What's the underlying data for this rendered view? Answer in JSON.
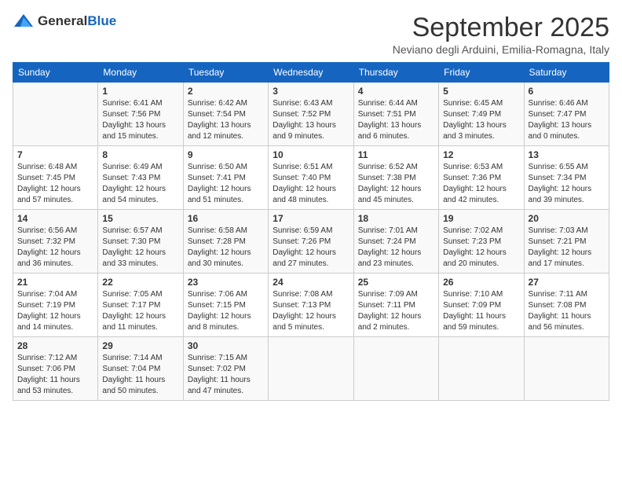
{
  "header": {
    "logo_general": "General",
    "logo_blue": "Blue",
    "month_title": "September 2025",
    "subtitle": "Neviano degli Arduini, Emilia-Romagna, Italy"
  },
  "days_of_week": [
    "Sunday",
    "Monday",
    "Tuesday",
    "Wednesday",
    "Thursday",
    "Friday",
    "Saturday"
  ],
  "weeks": [
    [
      {
        "day": "",
        "info": ""
      },
      {
        "day": "1",
        "info": "Sunrise: 6:41 AM\nSunset: 7:56 PM\nDaylight: 13 hours\nand 15 minutes."
      },
      {
        "day": "2",
        "info": "Sunrise: 6:42 AM\nSunset: 7:54 PM\nDaylight: 13 hours\nand 12 minutes."
      },
      {
        "day": "3",
        "info": "Sunrise: 6:43 AM\nSunset: 7:52 PM\nDaylight: 13 hours\nand 9 minutes."
      },
      {
        "day": "4",
        "info": "Sunrise: 6:44 AM\nSunset: 7:51 PM\nDaylight: 13 hours\nand 6 minutes."
      },
      {
        "day": "5",
        "info": "Sunrise: 6:45 AM\nSunset: 7:49 PM\nDaylight: 13 hours\nand 3 minutes."
      },
      {
        "day": "6",
        "info": "Sunrise: 6:46 AM\nSunset: 7:47 PM\nDaylight: 13 hours\nand 0 minutes."
      }
    ],
    [
      {
        "day": "7",
        "info": "Sunrise: 6:48 AM\nSunset: 7:45 PM\nDaylight: 12 hours\nand 57 minutes."
      },
      {
        "day": "8",
        "info": "Sunrise: 6:49 AM\nSunset: 7:43 PM\nDaylight: 12 hours\nand 54 minutes."
      },
      {
        "day": "9",
        "info": "Sunrise: 6:50 AM\nSunset: 7:41 PM\nDaylight: 12 hours\nand 51 minutes."
      },
      {
        "day": "10",
        "info": "Sunrise: 6:51 AM\nSunset: 7:40 PM\nDaylight: 12 hours\nand 48 minutes."
      },
      {
        "day": "11",
        "info": "Sunrise: 6:52 AM\nSunset: 7:38 PM\nDaylight: 12 hours\nand 45 minutes."
      },
      {
        "day": "12",
        "info": "Sunrise: 6:53 AM\nSunset: 7:36 PM\nDaylight: 12 hours\nand 42 minutes."
      },
      {
        "day": "13",
        "info": "Sunrise: 6:55 AM\nSunset: 7:34 PM\nDaylight: 12 hours\nand 39 minutes."
      }
    ],
    [
      {
        "day": "14",
        "info": "Sunrise: 6:56 AM\nSunset: 7:32 PM\nDaylight: 12 hours\nand 36 minutes."
      },
      {
        "day": "15",
        "info": "Sunrise: 6:57 AM\nSunset: 7:30 PM\nDaylight: 12 hours\nand 33 minutes."
      },
      {
        "day": "16",
        "info": "Sunrise: 6:58 AM\nSunset: 7:28 PM\nDaylight: 12 hours\nand 30 minutes."
      },
      {
        "day": "17",
        "info": "Sunrise: 6:59 AM\nSunset: 7:26 PM\nDaylight: 12 hours\nand 27 minutes."
      },
      {
        "day": "18",
        "info": "Sunrise: 7:01 AM\nSunset: 7:24 PM\nDaylight: 12 hours\nand 23 minutes."
      },
      {
        "day": "19",
        "info": "Sunrise: 7:02 AM\nSunset: 7:23 PM\nDaylight: 12 hours\nand 20 minutes."
      },
      {
        "day": "20",
        "info": "Sunrise: 7:03 AM\nSunset: 7:21 PM\nDaylight: 12 hours\nand 17 minutes."
      }
    ],
    [
      {
        "day": "21",
        "info": "Sunrise: 7:04 AM\nSunset: 7:19 PM\nDaylight: 12 hours\nand 14 minutes."
      },
      {
        "day": "22",
        "info": "Sunrise: 7:05 AM\nSunset: 7:17 PM\nDaylight: 12 hours\nand 11 minutes."
      },
      {
        "day": "23",
        "info": "Sunrise: 7:06 AM\nSunset: 7:15 PM\nDaylight: 12 hours\nand 8 minutes."
      },
      {
        "day": "24",
        "info": "Sunrise: 7:08 AM\nSunset: 7:13 PM\nDaylight: 12 hours\nand 5 minutes."
      },
      {
        "day": "25",
        "info": "Sunrise: 7:09 AM\nSunset: 7:11 PM\nDaylight: 12 hours\nand 2 minutes."
      },
      {
        "day": "26",
        "info": "Sunrise: 7:10 AM\nSunset: 7:09 PM\nDaylight: 11 hours\nand 59 minutes."
      },
      {
        "day": "27",
        "info": "Sunrise: 7:11 AM\nSunset: 7:08 PM\nDaylight: 11 hours\nand 56 minutes."
      }
    ],
    [
      {
        "day": "28",
        "info": "Sunrise: 7:12 AM\nSunset: 7:06 PM\nDaylight: 11 hours\nand 53 minutes."
      },
      {
        "day": "29",
        "info": "Sunrise: 7:14 AM\nSunset: 7:04 PM\nDaylight: 11 hours\nand 50 minutes."
      },
      {
        "day": "30",
        "info": "Sunrise: 7:15 AM\nSunset: 7:02 PM\nDaylight: 11 hours\nand 47 minutes."
      },
      {
        "day": "",
        "info": ""
      },
      {
        "day": "",
        "info": ""
      },
      {
        "day": "",
        "info": ""
      },
      {
        "day": "",
        "info": ""
      }
    ]
  ]
}
